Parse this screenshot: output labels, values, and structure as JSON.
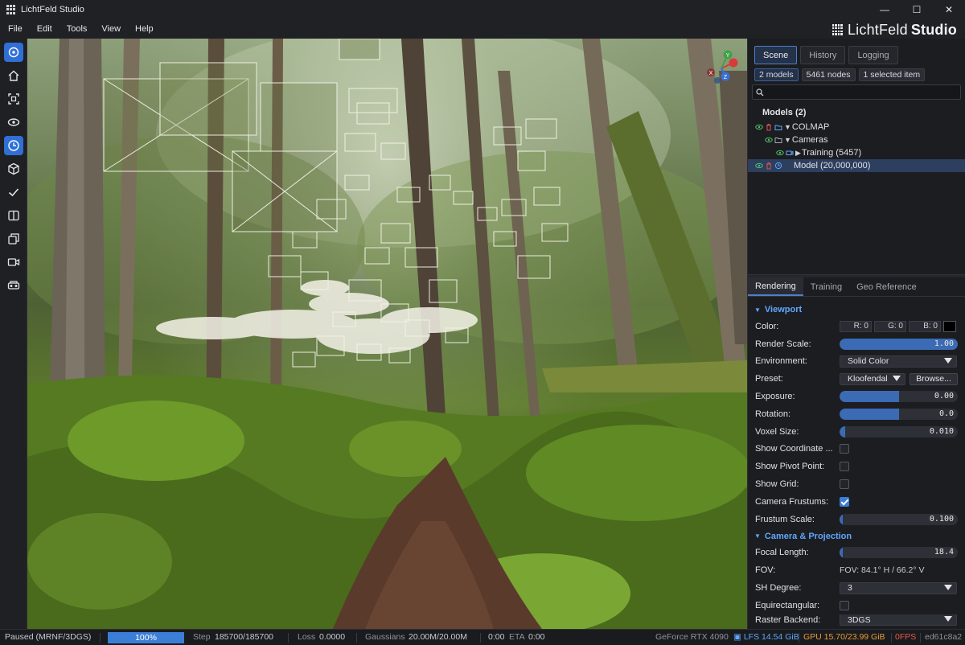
{
  "window": {
    "title": "LichtFeld Studio",
    "minimize": "—",
    "maximize": "☐",
    "close": "✕"
  },
  "menu": [
    "File",
    "Edit",
    "Tools",
    "View",
    "Help"
  ],
  "brand": {
    "light": "LichtFeld",
    "bold": "Studio"
  },
  "toolbar": [
    {
      "icon": "rotate-icon",
      "active": true
    },
    {
      "icon": "home-icon",
      "active": false
    },
    {
      "icon": "frame-icon",
      "active": false
    },
    {
      "icon": "eye-icon",
      "active": false
    },
    {
      "icon": "clock-icon",
      "active": true
    },
    {
      "icon": "cube-icon",
      "active": false
    },
    {
      "icon": "checkmark-icon",
      "active": false
    },
    {
      "icon": "split-view-icon",
      "active": false
    },
    {
      "icon": "layers-icon",
      "active": false
    },
    {
      "icon": "video-camera-icon",
      "active": false
    },
    {
      "icon": "vr-icon",
      "active": false
    }
  ],
  "gizmo": {
    "x": "X",
    "y": "Y",
    "z": "Z"
  },
  "scene_panel": {
    "tabs": [
      "Scene",
      "History",
      "Logging"
    ],
    "active_tab": "Scene",
    "chips": [
      "2 models",
      "5461 nodes",
      "1 selected item"
    ],
    "search_placeholder": "",
    "tree_title": "Models (2)",
    "tree": [
      {
        "label": "COLMAP",
        "depth": 0,
        "caret": "▼"
      },
      {
        "label": "Cameras",
        "depth": 1,
        "caret": "▼"
      },
      {
        "label": "Training (5457)",
        "depth": 2,
        "caret": "▶"
      },
      {
        "label": "Model (20,000,000)",
        "depth": 0,
        "caret": ""
      }
    ]
  },
  "props_panel": {
    "tabs": [
      "Rendering",
      "Training",
      "Geo Reference"
    ],
    "active_tab": "Rendering",
    "viewport_section": "Viewport",
    "color_label": "Color:",
    "color": {
      "r": "R: 0",
      "g": "G: 0",
      "b": "B: 0",
      "swatch": "#000000"
    },
    "render_scale": {
      "label": "Render Scale:",
      "value": "1.00",
      "fraction": 1.0
    },
    "environment": {
      "label": "Environment:",
      "value": "Solid Color"
    },
    "preset": {
      "label": "Preset:",
      "value": "Kloofendal",
      "browse": "Browse..."
    },
    "exposure": {
      "label": "Exposure:",
      "value": "0.00",
      "fraction": 0.5
    },
    "rotation": {
      "label": "Rotation:",
      "value": "0.0",
      "fraction": 0.5
    },
    "voxel_size": {
      "label": "Voxel Size:",
      "value": "0.010",
      "fraction": 0.05
    },
    "show_coordinate": {
      "label": "Show Coordinate ...",
      "checked": false
    },
    "show_pivot": {
      "label": "Show Pivot Point:",
      "checked": false
    },
    "show_grid": {
      "label": "Show Grid:",
      "checked": false
    },
    "camera_frustums": {
      "label": "Camera Frustums:",
      "checked": true
    },
    "frustum_scale": {
      "label": "Frustum Scale:",
      "value": "0.100",
      "fraction": 0.02
    },
    "camera_section": "Camera & Projection",
    "focal_length": {
      "label": "Focal Length:",
      "value": "18.4",
      "fraction": 0.03
    },
    "fov": {
      "label": "FOV:",
      "value": "FOV: 84.1° H / 66.2° V"
    },
    "sh_degree": {
      "label": "SH Degree:",
      "value": "3"
    },
    "equirectangular": {
      "label": "Equirectangular:",
      "checked": false
    },
    "raster_backend": {
      "label": "Raster Backend:",
      "value": "3DGS"
    }
  },
  "status": {
    "state": "Paused (MRNF/3DGS)",
    "progress": "100%",
    "progress_fraction": 1.0,
    "step_label": "Step",
    "step_value": "185700/185700",
    "loss_label": "Loss",
    "loss_value": "0.0000",
    "gaussians_label": "Gaussians",
    "gaussians_value": "20.00M/20.00M",
    "time": "0:00",
    "eta_label": "ETA",
    "eta_value": "0:00",
    "gpu_name": "GeForce RTX 4090",
    "lfs": "LFS 14.54 GiB",
    "gpu_mem": "GPU 15.70/23.99 GiB",
    "fps": "0FPS",
    "commit": "ed61c8a2"
  },
  "colors": {
    "accent": "#3b7ed8",
    "section": "#5fa7ff",
    "lfs": "#5fa7ff",
    "gpu": "#e89a3a",
    "fps": "#e8564a"
  }
}
